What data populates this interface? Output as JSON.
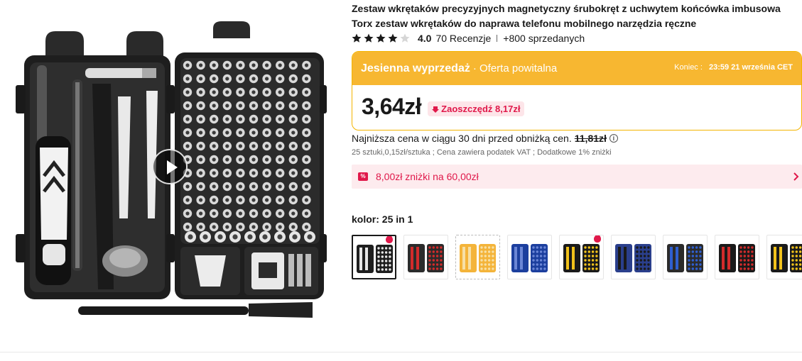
{
  "product": {
    "title": "Zestaw wkrętaków precyzyjnych magnetyczny śrubokręt z uchwytem końcówka imbusowa Torx zestaw wkrętaków do naprawa telefonu mobilnego narzędzia ręczne",
    "rating": "4.0",
    "rating_value": 4.0,
    "reviews": "70 Recenzje",
    "sold": "+800 sprzedanych"
  },
  "sale": {
    "name": "Jesienna wyprzedaż",
    "subtitle": "· Oferta powitalna",
    "end_label": "Koniec :",
    "end_time": "23:59 21 września CET",
    "price": "3,64zł",
    "savings": "Zaoszczędź 8,17zł"
  },
  "pricing": {
    "lowest_label": "Najniższa cena w ciągu 30 dni przed obniżką cen.",
    "lowest_old": "11,81zł",
    "details": "25 sztuki,0,15zł/sztuka ; Cena zawiera podatek VAT ; Dodatkowe 1% zniżki"
  },
  "coupon": {
    "icon_text": "%",
    "text": "8,00zł zniżki na 60,00zł"
  },
  "variant": {
    "label": "kolor: 25 in 1",
    "thumb_count": 9
  },
  "colors": {
    "accent": "#f7b731",
    "sale_red": "#e0184a",
    "star": "#191919"
  },
  "icons": [
    "play-icon",
    "star-icon",
    "arrow-down-icon",
    "info-icon",
    "coupon-icon",
    "chevron-right-icon",
    "hot-icon"
  ]
}
